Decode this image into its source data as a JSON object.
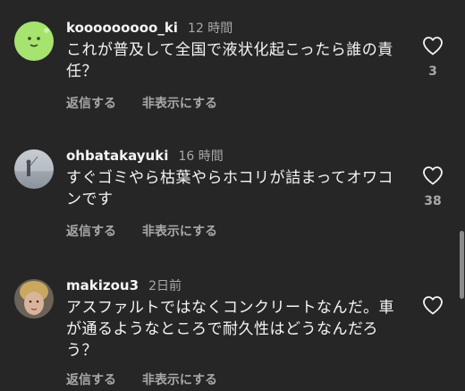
{
  "comments": [
    {
      "username": "kooooooooo_ki",
      "time": "12 時間",
      "text": "これが普及して全国で液状化起こったら誰の責任？",
      "reply_label": "返信する",
      "hide_label": "非表示にする",
      "likes": "3"
    },
    {
      "username": "ohbatakayuki",
      "time": "16 時間",
      "text": "すぐゴミやら枯葉やらホコリが詰まってオワコンです",
      "reply_label": "返信する",
      "hide_label": "非表示にする",
      "likes": "38"
    },
    {
      "username": "makizou3",
      "time": "2日前",
      "text": "アスファルトではなくコンクリートなんだ。車が通るようなところで耐久性はどうなんだろう？",
      "reply_label": "返信する",
      "hide_label": "非表示にする"
    }
  ],
  "icons": {
    "like": "heart-outline-icon"
  },
  "colors": {
    "background": "#262626",
    "text_primary": "#f5f5f5",
    "text_secondary": "#a8a8a8",
    "avatar_green": "#a7e36f"
  }
}
